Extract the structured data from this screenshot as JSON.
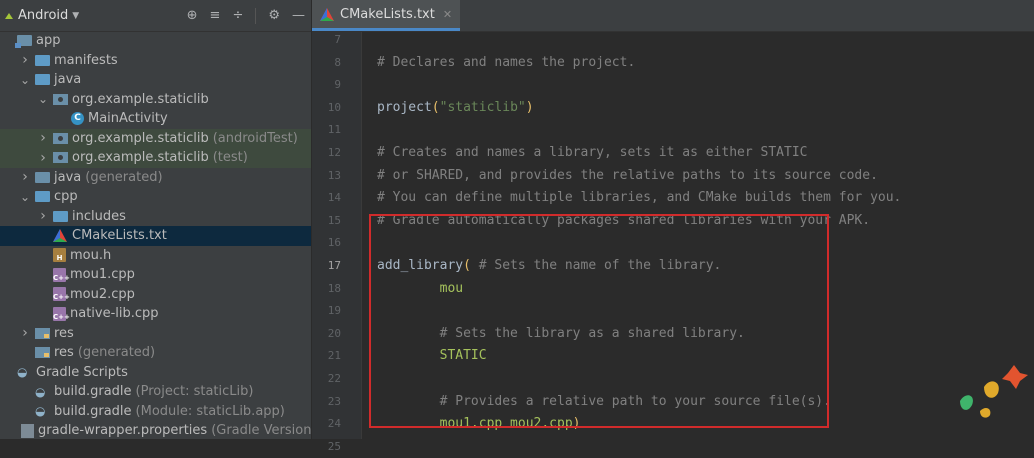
{
  "project_panel": {
    "view_selector": "Android",
    "toolbar_icons": [
      "locate-icon",
      "expand-all-icon",
      "collapse-all-icon",
      "gear-icon",
      "hide-icon"
    ],
    "tree": [
      {
        "label": "app",
        "hint": "",
        "icon": "module-folder-icon",
        "arrow": "",
        "indent": 0
      },
      {
        "label": "manifests",
        "hint": "",
        "icon": "folder-icon",
        "arrow": "right",
        "indent": 1
      },
      {
        "label": "java",
        "hint": "",
        "icon": "folder-icon",
        "arrow": "down",
        "indent": 1
      },
      {
        "label": "org.example.staticlib",
        "hint": "",
        "icon": "package-icon",
        "arrow": "down",
        "indent": 2
      },
      {
        "label": "MainActivity",
        "hint": "",
        "icon": "class-icon",
        "arrow": "",
        "indent": 3
      },
      {
        "label": "org.example.staticlib",
        "hint": "(androidTest)",
        "icon": "package-icon",
        "arrow": "right",
        "indent": 2
      },
      {
        "label": "org.example.staticlib",
        "hint": "(test)",
        "icon": "package-icon",
        "arrow": "right",
        "indent": 2
      },
      {
        "label": "java",
        "hint": "(generated)",
        "icon": "generated-folder-icon",
        "arrow": "right",
        "indent": 1
      },
      {
        "label": "cpp",
        "hint": "",
        "icon": "folder-icon",
        "arrow": "down",
        "indent": 1
      },
      {
        "label": "includes",
        "hint": "",
        "icon": "folder-icon",
        "arrow": "right",
        "indent": 2
      },
      {
        "label": "CMakeLists.txt",
        "hint": "",
        "icon": "cmake-icon",
        "arrow": "",
        "indent": 2
      },
      {
        "label": "mou.h",
        "hint": "",
        "icon": "header-file-icon",
        "arrow": "",
        "indent": 2
      },
      {
        "label": "mou1.cpp",
        "hint": "",
        "icon": "cpp-file-icon",
        "arrow": "",
        "indent": 2
      },
      {
        "label": "mou2.cpp",
        "hint": "",
        "icon": "cpp-file-icon",
        "arrow": "",
        "indent": 2
      },
      {
        "label": "native-lib.cpp",
        "hint": "",
        "icon": "cpp-file-icon",
        "arrow": "",
        "indent": 2
      },
      {
        "label": "res",
        "hint": "",
        "icon": "res-folder-icon",
        "arrow": "right",
        "indent": 1
      },
      {
        "label": "res",
        "hint": "(generated)",
        "icon": "res-folder-icon",
        "arrow": "",
        "indent": 1
      },
      {
        "label": "Gradle Scripts",
        "hint": "",
        "icon": "gradle-icon",
        "arrow": "",
        "indent": 0
      },
      {
        "label": "build.gradle",
        "hint": "(Project: staticLib)",
        "icon": "gradle-icon",
        "arrow": "",
        "indent": 1
      },
      {
        "label": "build.gradle",
        "hint": "(Module: staticLib.app)",
        "icon": "gradle-icon",
        "arrow": "",
        "indent": 1
      },
      {
        "label": "gradle-wrapper.properties",
        "hint": "(Gradle Version)",
        "icon": "properties-file-icon",
        "arrow": "",
        "indent": 1
      }
    ]
  },
  "editor": {
    "tab_title": "CMakeLists.txt",
    "current_line": "17",
    "lines": [
      {
        "num": "7",
        "segments": []
      },
      {
        "num": "8",
        "segments": [
          {
            "cls": "cmt",
            "text": "# Declares and names the project."
          }
        ]
      },
      {
        "num": "9",
        "segments": []
      },
      {
        "num": "10",
        "segments": [
          {
            "cls": "fn",
            "text": "project"
          },
          {
            "cls": "paren",
            "text": "("
          },
          {
            "cls": "str",
            "text": "\"staticlib\""
          },
          {
            "cls": "paren",
            "text": ")"
          }
        ]
      },
      {
        "num": "11",
        "segments": []
      },
      {
        "num": "12",
        "segments": [
          {
            "cls": "cmt",
            "text": "# Creates and names a library, sets it as either STATIC"
          }
        ]
      },
      {
        "num": "13",
        "segments": [
          {
            "cls": "cmt",
            "text": "# or SHARED, and provides the relative paths to its source code."
          }
        ]
      },
      {
        "num": "14",
        "segments": [
          {
            "cls": "cmt",
            "text": "# You can define multiple libraries, and CMake builds them for you."
          }
        ]
      },
      {
        "num": "15",
        "segments": [
          {
            "cls": "cmt",
            "text": "# Gradle automatically packages shared libraries with your APK."
          }
        ]
      },
      {
        "num": "16",
        "segments": []
      },
      {
        "num": "17",
        "segments": [
          {
            "cls": "fn",
            "text": "add_library"
          },
          {
            "cls": "paren",
            "text": "("
          },
          {
            "cls": "cmt",
            "text": " # Sets the name of the library."
          }
        ]
      },
      {
        "num": "18",
        "segments": [
          {
            "cls": "arg",
            "text": "        mou"
          }
        ]
      },
      {
        "num": "19",
        "segments": []
      },
      {
        "num": "20",
        "segments": [
          {
            "cls": "cmt",
            "text": "        # Sets the library as a shared library."
          }
        ]
      },
      {
        "num": "21",
        "segments": [
          {
            "cls": "arg",
            "text": "        STATIC"
          }
        ]
      },
      {
        "num": "22",
        "segments": []
      },
      {
        "num": "23",
        "segments": [
          {
            "cls": "cmt",
            "text": "        # Provides a relative path to your source file(s)."
          }
        ]
      },
      {
        "num": "24",
        "segments": [
          {
            "cls": "arg",
            "text": "        mou1.cpp mou2.cpp"
          },
          {
            "cls": "paren",
            "text": ")"
          }
        ]
      },
      {
        "num": "25",
        "segments": []
      }
    ]
  },
  "colors": {
    "editor_bg": "#2b2b2b",
    "panel_bg": "#3c3f41",
    "selection": "#0d293e",
    "highlight_box": "#d12b2b",
    "comment": "#808080",
    "string": "#6a8759",
    "argument": "#a5c25c",
    "paren": "#e8bf6a"
  }
}
